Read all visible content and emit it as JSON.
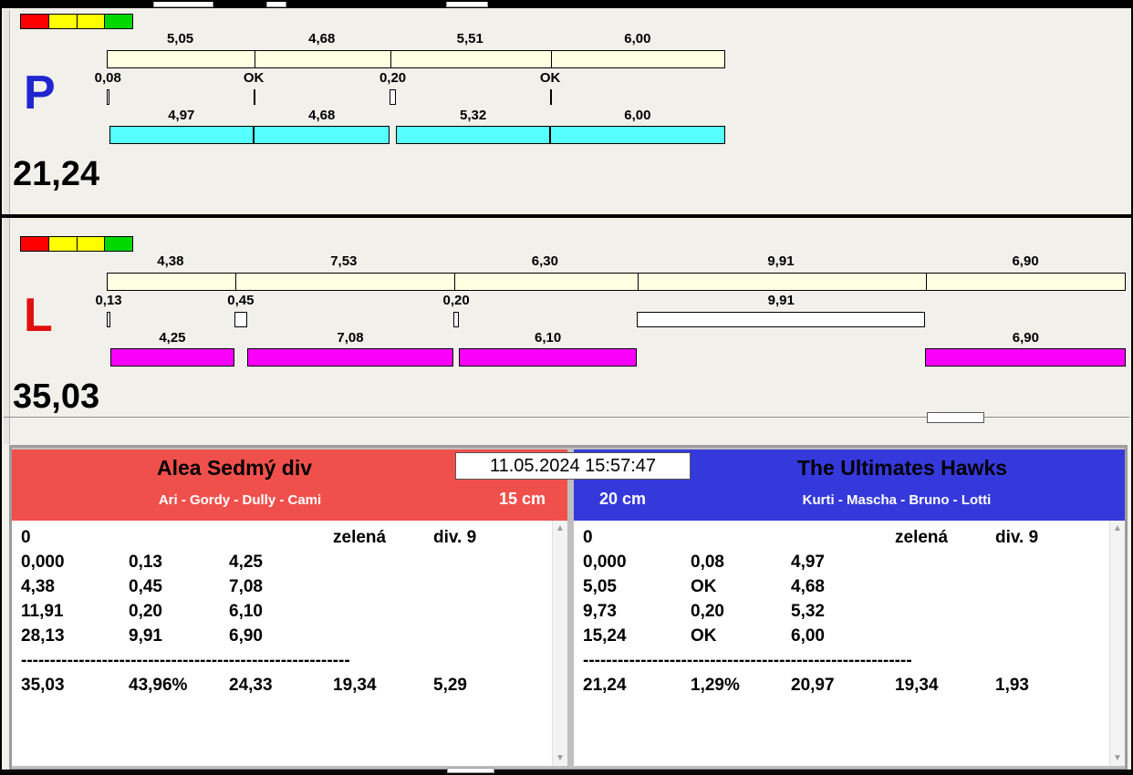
{
  "timestamp": "11.05.2024 15:57:47",
  "colors": {
    "reference_bar": "#FFFFE2",
    "team_left": "#F0504C",
    "team_right": "#3539DC"
  },
  "panels": [
    {
      "letter": "P",
      "letter_color": "#2026CE",
      "total_label": "21,24",
      "bar_fill": "#55FFFF",
      "scale_units": 21.24,
      "status_colors": [
        "#FF0000",
        "#FFFF00",
        "#FFFF00",
        "#00D800"
      ],
      "top_segments": [
        {
          "label": "5,05",
          "len": 5.05
        },
        {
          "label": "4,68",
          "len": 4.68
        },
        {
          "label": "5,51",
          "len": 5.51
        },
        {
          "label": "6,00",
          "len": 6.0
        }
      ],
      "markers": [
        {
          "label": "0,08",
          "pos": 0.0,
          "len": 0.08,
          "type": "box"
        },
        {
          "label": "OK",
          "pos": 5.05,
          "len": 0,
          "type": "line"
        },
        {
          "label": "0,20",
          "pos": 9.73,
          "len": 0.2,
          "type": "box"
        },
        {
          "label": "OK",
          "pos": 15.24,
          "len": 0,
          "type": "line"
        }
      ],
      "bottom_segments": [
        {
          "label": "4,97",
          "start": 0.08,
          "len": 4.97
        },
        {
          "label": "4,68",
          "start": 5.05,
          "len": 4.68
        },
        {
          "label": "5,32",
          "start": 9.93,
          "len": 5.32
        },
        {
          "label": "6,00",
          "start": 15.24,
          "len": 6.0
        }
      ]
    },
    {
      "letter": "L",
      "letter_color": "#E01010",
      "total_label": "35,03",
      "bar_fill": "#FA00FA",
      "scale_units": 35.03,
      "status_colors": [
        "#FF0000",
        "#FFFF00",
        "#FFFF00",
        "#00D800"
      ],
      "top_segments": [
        {
          "label": "4,38",
          "len": 4.38
        },
        {
          "label": "7,53",
          "len": 7.53
        },
        {
          "label": "6,30",
          "len": 6.3
        },
        {
          "label": "9,91",
          "len": 9.91
        },
        {
          "label": "6,90",
          "len": 6.9
        }
      ],
      "markers": [
        {
          "label": "0,13",
          "pos": 0.0,
          "len": 0.13,
          "type": "box"
        },
        {
          "label": "0,45",
          "pos": 4.38,
          "len": 0.45,
          "type": "box"
        },
        {
          "label": "0,20",
          "pos": 11.91,
          "len": 0.2,
          "type": "box"
        },
        {
          "label": "9,91",
          "pos": 18.22,
          "len": 9.91,
          "type": "box"
        }
      ],
      "bottom_segments": [
        {
          "label": "4,25",
          "start": 0.13,
          "len": 4.25
        },
        {
          "label": "7,08",
          "start": 4.83,
          "len": 7.08
        },
        {
          "label": "6,10",
          "start": 12.11,
          "len": 6.1
        },
        {
          "label": "6,90",
          "start": 28.13,
          "len": 6.9
        }
      ]
    }
  ],
  "teams": [
    {
      "name": "Alea Sedmý div",
      "players": "Ari - Gordy - Dully - Cami",
      "size_label": "15 cm",
      "color": "#F0504C",
      "rows": [
        [
          "0",
          "",
          "",
          "zelená",
          "div. 9"
        ],
        [
          "0,000",
          "0,13",
          "4,25",
          "",
          ""
        ],
        [
          "4,38",
          "0,45",
          "7,08",
          "",
          ""
        ],
        [
          "11,91",
          "0,20",
          "6,10",
          "",
          ""
        ],
        [
          "28,13",
          "9,91",
          "6,90",
          "",
          ""
        ],
        "---------------------------------------------------------",
        [
          "35,03",
          "43,96%",
          "24,33",
          "19,34",
          "5,29"
        ]
      ]
    },
    {
      "name": "The Ultimates Hawks",
      "players": "Kurti - Mascha - Bruno - Lotti",
      "size_label": "20 cm",
      "color": "#3539DC",
      "rows": [
        [
          "0",
          "",
          "",
          "zelená",
          "div. 9"
        ],
        [
          "0,000",
          "0,08",
          "4,97",
          "",
          ""
        ],
        [
          "5,05",
          "OK",
          "4,68",
          "",
          ""
        ],
        [
          "9,73",
          "0,20",
          "5,32",
          "",
          ""
        ],
        [
          "15,24",
          "OK",
          "6,00",
          "",
          ""
        ],
        "---------------------------------------------------------",
        [
          "21,24",
          "1,29%",
          "20,97",
          "19,34",
          "1,93"
        ]
      ]
    }
  ],
  "scrollbar": {
    "up_glyph": "▲",
    "down_glyph": "▼"
  }
}
